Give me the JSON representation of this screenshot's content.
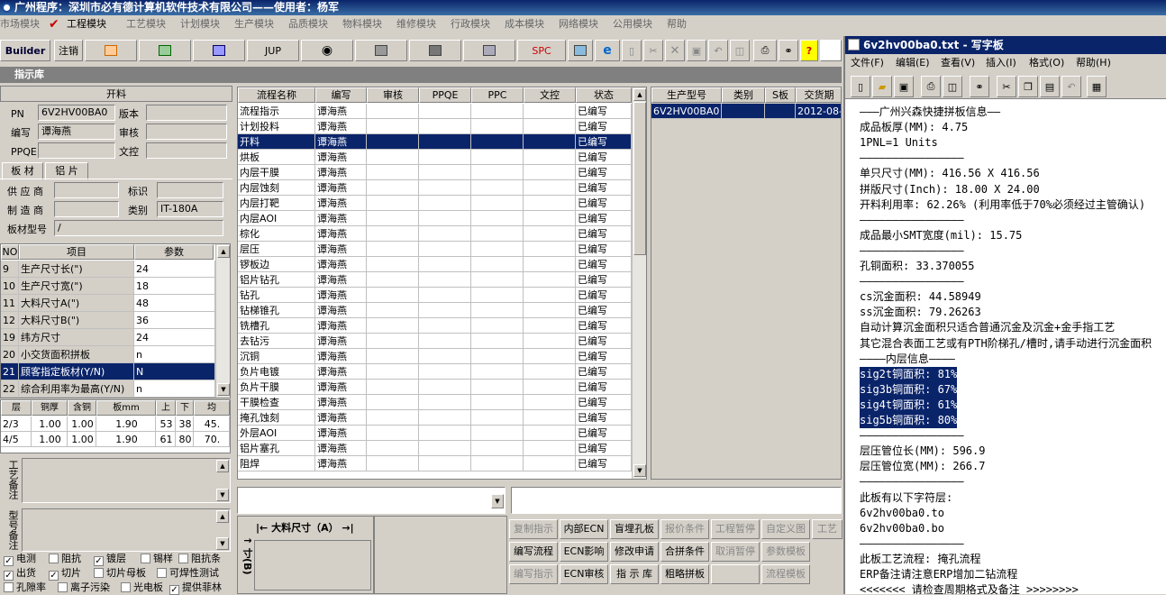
{
  "app": {
    "title": "广州程序：深圳市必有德计算机软件技术有限公司——使用者：杨军"
  },
  "menu": [
    "市场模块",
    "工程模块",
    "工艺模块",
    "计划模块",
    "生产模块",
    "品质模块",
    "物料模块",
    "维修模块",
    "行政模块",
    "成本模块",
    "网络模块",
    "公用模块",
    "帮助"
  ],
  "toolbar": {
    "builder": "Builder",
    "logout": "注销",
    "jup": "JUP",
    "spc": "SPC"
  },
  "section_title": "指示库",
  "form": {
    "header": "开料",
    "pn_label": "PN",
    "pn_value": "6V2HV00BA0",
    "version_label": "版本",
    "version_value": "",
    "writer_label": "编写",
    "writer_value": "谭海燕",
    "review_label": "审核",
    "review_value": "",
    "ppqe_label": "PPQE",
    "ppqe_value": "",
    "doc_label": "文控",
    "doc_value": "",
    "tab_material": "板 材",
    "tab_copper": "铝 片",
    "supplier_label": "供 应 商",
    "supplier_value": "",
    "mark_label": "标识",
    "mark_value": "",
    "maker_label": "制 造 商",
    "maker_value": "",
    "type_label": "类别",
    "type_value": "IT-180A",
    "model_label": "板材型号",
    "model_value": "/"
  },
  "params": {
    "headers": [
      "NO",
      "项目",
      "参数"
    ],
    "rows": [
      [
        "9",
        "生产尺寸长(\")",
        "24"
      ],
      [
        "10",
        "生产尺寸宽(\")",
        "18"
      ],
      [
        "11",
        "大料尺寸A(\")",
        "48"
      ],
      [
        "12",
        "大料尺寸B(\")",
        "36"
      ],
      [
        "19",
        "纬方尺寸",
        "24"
      ],
      [
        "20",
        "小交货面积拼板",
        "n"
      ],
      [
        "21",
        "顾客指定板材(Y/N)",
        "N"
      ],
      [
        "22",
        "综合利用率为最高(Y/N)",
        "n"
      ]
    ],
    "selected": 6
  },
  "layers": {
    "headers": [
      "层",
      "铜厚(OZ)",
      "含铜mm",
      "板mm",
      "上",
      "下",
      "均"
    ],
    "rows": [
      [
        "2/3",
        "1.00",
        "1.00",
        "1.90",
        "53",
        "38",
        "45."
      ],
      [
        "4/5",
        "1.00",
        "1.00",
        "1.90",
        "61",
        "80",
        "70."
      ]
    ]
  },
  "notes": {
    "craft": "工艺备注",
    "model": "型号备注"
  },
  "checks": [
    {
      "label": "电测",
      "checked": true
    },
    {
      "label": "阻抗",
      "checked": false
    },
    {
      "label": "镀层",
      "checked": true
    },
    {
      "label": "锡样",
      "checked": false
    },
    {
      "label": "阻抗条",
      "checked": false
    },
    {
      "label": "出货",
      "checked": true
    },
    {
      "label": "切片",
      "checked": true
    },
    {
      "label": "切片母板",
      "checked": false
    },
    {
      "label": "可焊性测试",
      "checked": false
    },
    {
      "label": "孔隙率",
      "checked": false
    },
    {
      "label": "离子污染",
      "checked": false
    },
    {
      "label": "光电板",
      "checked": false
    },
    {
      "label": "提供菲林",
      "checked": true
    }
  ],
  "flow": {
    "headers": [
      "流程名称",
      "编写",
      "审核",
      "PPQE",
      "PPC",
      "文控",
      "状态"
    ],
    "rows": [
      [
        "流程指示",
        "谭海燕",
        "已编写"
      ],
      [
        "计划投料",
        "谭海燕",
        "已编写"
      ],
      [
        "开料",
        "谭海燕",
        "已编写"
      ],
      [
        "烘板",
        "谭海燕",
        "已编写"
      ],
      [
        "内层干膜",
        "谭海燕",
        "已编写"
      ],
      [
        "内层蚀刻",
        "谭海燕",
        "已编写"
      ],
      [
        "内层打靶",
        "谭海燕",
        "已编写"
      ],
      [
        "内层AOI",
        "谭海燕",
        "已编写"
      ],
      [
        "棕化",
        "谭海燕",
        "已编写"
      ],
      [
        "层压",
        "谭海燕",
        "已编写"
      ],
      [
        "锣板边",
        "谭海燕",
        "已编写"
      ],
      [
        "铝片钻孔",
        "谭海燕",
        "已编写"
      ],
      [
        "钻孔",
        "谭海燕",
        "已编写"
      ],
      [
        "钻梯锥孔",
        "谭海燕",
        "已编写"
      ],
      [
        "铣槽孔",
        "谭海燕",
        "已编写"
      ],
      [
        "去钻污",
        "谭海燕",
        "已编写"
      ],
      [
        "沉铜",
        "谭海燕",
        "已编写"
      ],
      [
        "负片电镀",
        "谭海燕",
        "已编写"
      ],
      [
        "负片干膜",
        "谭海燕",
        "已编写"
      ],
      [
        "干膜检查",
        "谭海燕",
        "已编写"
      ],
      [
        "掩孔蚀刻",
        "谭海燕",
        "已编写"
      ],
      [
        "外层AOI",
        "谭海燕",
        "已编写"
      ],
      [
        "铝片塞孔",
        "谭海燕",
        "已编写"
      ],
      [
        "阻焊",
        "谭海燕",
        "已编写"
      ]
    ],
    "selected": 2
  },
  "prod": {
    "headers": [
      "生产型号",
      "类别",
      "S板",
      "交货期"
    ],
    "rows": [
      [
        "6V2HV00BA0",
        "",
        "",
        "2012-08-"
      ]
    ]
  },
  "diagram": {
    "a_label": "大料尺寸（A）",
    "b_label": "寸(B)"
  },
  "buttons": [
    [
      {
        "l": "复制指示",
        "d": true
      },
      {
        "l": "内部ECN",
        "d": false
      },
      {
        "l": "盲埋孔板",
        "d": false
      },
      {
        "l": "报价条件",
        "d": true
      },
      {
        "l": "工程暂停",
        "d": true
      },
      {
        "l": "自定义图",
        "d": true
      },
      {
        "l": "工艺计",
        "d": true
      }
    ],
    [
      {
        "l": "编写流程",
        "d": false
      },
      {
        "l": "ECN影响",
        "d": false
      },
      {
        "l": "修改申请",
        "d": false
      },
      {
        "l": "合拼条件",
        "d": false
      },
      {
        "l": "取消暂停",
        "d": true
      },
      {
        "l": "参数模板",
        "d": true
      }
    ],
    [
      {
        "l": "编写指示",
        "d": true
      },
      {
        "l": "ECN审核",
        "d": false
      },
      {
        "l": "指 示 库",
        "d": false
      },
      {
        "l": "粗略拼板",
        "d": false
      },
      {
        "l": "",
        "d": true
      },
      {
        "l": "流程模板",
        "d": true
      }
    ]
  ],
  "wordpad": {
    "title": "6v2hv00ba0.txt - 写字板",
    "menu": [
      "文件(F)",
      "编辑(E)",
      "查看(V)",
      "插入(I)",
      "格式(O)",
      "帮助(H)"
    ],
    "lines": [
      "———广州兴森快捷拼板信息——",
      "成品板厚(MM): 4.75",
      "1PNL=1 Units",
      "————————————————",
      "单只尺寸(MM): 416.56 X 416.56",
      "拼版尺寸(Inch): 18.00 X 24.00",
      "开料利用率: 62.26% (利用率低于70%必须经过主管确认)",
      "————————————————",
      "成品最小SMT宽度(mil): 15.75",
      "————————————————",
      "孔铜面积: 33.370055",
      "————————————————",
      "cs沉金面积: 44.58949",
      "ss沉金面积: 79.26263",
      "自动计算沉金面积只适合普通沉金及沉金+金手指工艺",
      "其它混合表面工艺或有PTH阶梯孔/槽时,请手动进行沉金面积",
      "————内层信息————",
      "sig2t铜面积: 81%",
      "sig3b铜面积: 67%",
      "sig4t铜面积: 61%",
      "sig5b铜面积: 80%",
      "————————————————",
      "层压管位长(MM): 596.9",
      "层压管位宽(MM): 266.7",
      "————————————————",
      "此板有以下字符层:",
      "6v2hv00ba0.to",
      "6v2hv00ba0.bo",
      "————————————————",
      "此板工艺流程: 掩孔流程",
      "ERP备注请注意ERP增加二钻流程",
      "<<<<<<<_请检查周期格式及备注_>>>>>>>>"
    ],
    "highlight": [
      17,
      18,
      19,
      20
    ]
  }
}
